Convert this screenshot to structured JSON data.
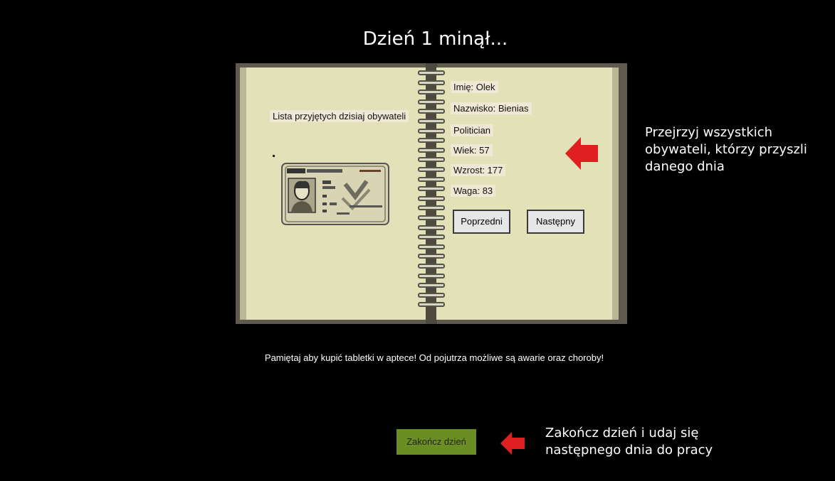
{
  "title": "Dzień 1 minął...",
  "notebook": {
    "left_heading": "Lista przyjętych dzisiaj obywateli",
    "citizen": {
      "name": "Imię: Olek",
      "surname": "Nazwisko: Bienias",
      "profession": "Politician",
      "age": "Wiek: 57",
      "height": "Wzrost: 177",
      "weight": "Waga: 83"
    },
    "prev_label": "Poprzedni",
    "next_label": "Następny"
  },
  "reminder": "Pamiętaj aby kupić tabletki w aptece! Od pojutrza możliwe są awarie oraz choroby!",
  "end_day_label": "Zakończ dzień",
  "hints": {
    "citizens_hint": [
      "Przejrzyj wszystkich",
      "obywateli, którzy przyszli",
      "danego dnia"
    ],
    "end_day_hint": [
      "Zakończ dzień i udaj się",
      "następnego dnia do pracy"
    ]
  },
  "colors": {
    "page": "#e2e1b8",
    "end_button": "#6b8e23",
    "arrow": "#e02020"
  }
}
